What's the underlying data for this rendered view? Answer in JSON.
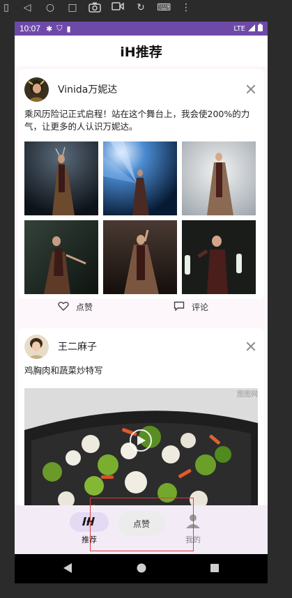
{
  "emulator_toolbar": {
    "icons": [
      "window-icon",
      "back-triangle-icon",
      "home-circle-icon",
      "overview-square-icon",
      "camera-icon",
      "video-icon",
      "rotate-icon",
      "keyboard-icon",
      "more-vertical-icon"
    ]
  },
  "statusbar": {
    "time": "10:07",
    "network": "LTE",
    "icons": [
      "gear-icon",
      "shield-icon",
      "sd-card-icon",
      "signal-icon",
      "battery-icon"
    ]
  },
  "header": {
    "title": "iH推荐"
  },
  "posts": [
    {
      "username": "Vinida万妮达",
      "text": "乘风历险记正式启程！站在这个舞台上，我会使200%的力气，让更多的人认识万妮达。",
      "photo_count": 6,
      "actions": {
        "like": "点赞",
        "comment": "评论"
      }
    },
    {
      "username": "王二麻子",
      "text": "鸡胸肉和蔬菜炒特写",
      "watermark": "图图网"
    }
  ],
  "bottom_nav": {
    "items": [
      {
        "label": "推荐",
        "icon": "ih-logo-icon",
        "active": true
      },
      {
        "label": "我的",
        "icon": "person-icon",
        "active": false
      }
    ],
    "toast": "点赞"
  },
  "colors": {
    "statusbar": "#6e4aa8",
    "nav_background": "#f3ecf7",
    "nav_active_pill": "#e4daf4",
    "highlight_border": "#e53935"
  }
}
